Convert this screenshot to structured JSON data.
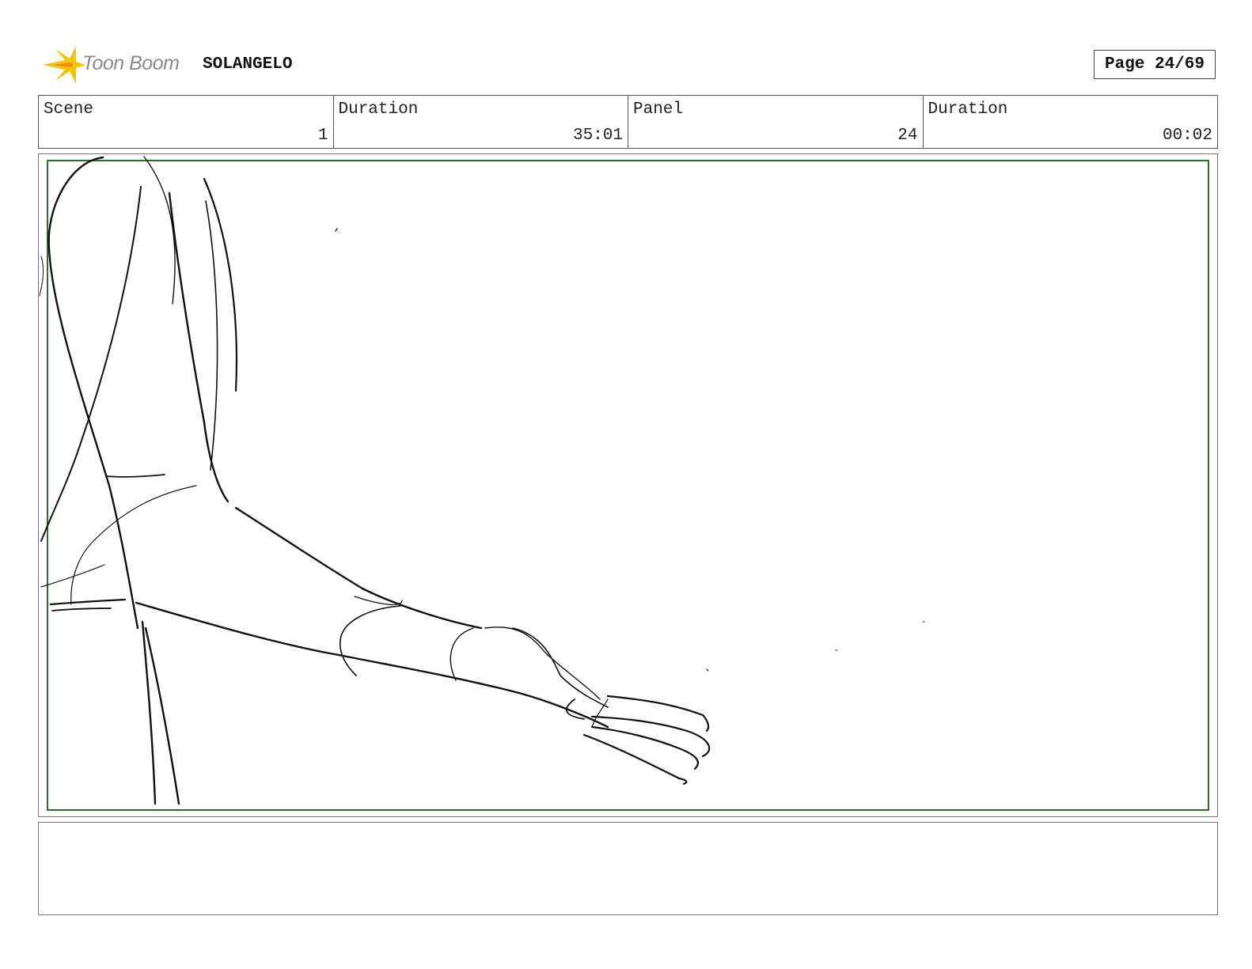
{
  "header": {
    "logo_text": "Toon Boom",
    "project_title": "SOLANGELO",
    "page_label": "Page 24/69"
  },
  "info": {
    "scene_label": "Scene",
    "scene_value": "1",
    "scene_duration_label": "Duration",
    "scene_duration_value": "35:01",
    "panel_label": "Panel",
    "panel_value": "24",
    "panel_duration_label": "Duration",
    "panel_duration_value": "00:02"
  },
  "colors": {
    "safe_frame": "#2e6b2e",
    "logo_yellow": "#f5c400",
    "logo_text": "#8a8a8a"
  },
  "icons": [
    "toon-boom-logo-icon"
  ]
}
